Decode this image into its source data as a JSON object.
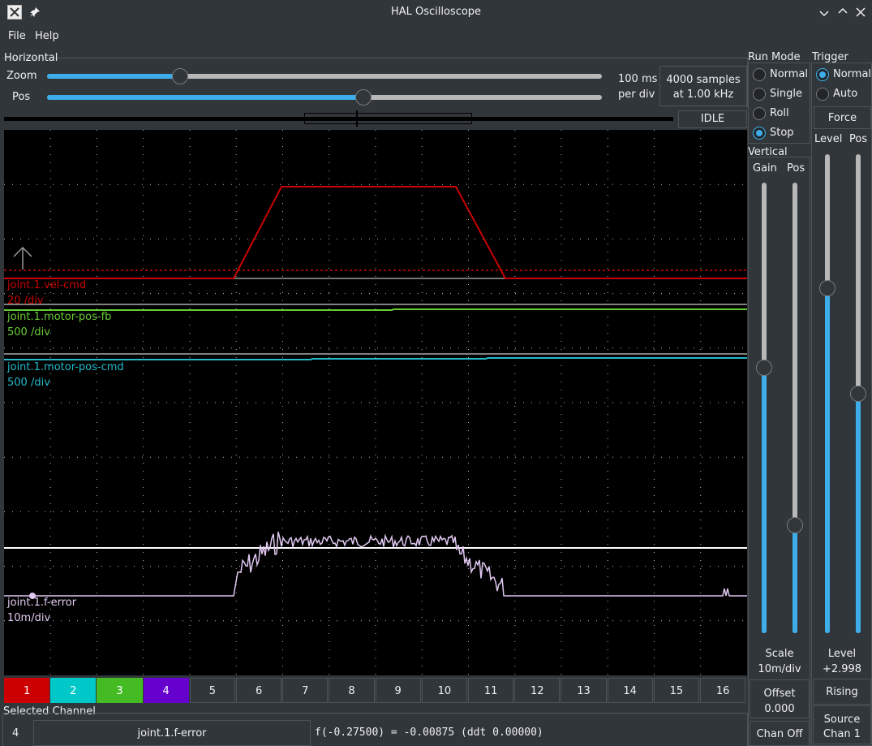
{
  "window": {
    "title": "HAL Oscilloscope",
    "icons": [
      "app-icon",
      "pin-icon",
      "minimize-icon",
      "maximize-icon",
      "close-icon"
    ]
  },
  "menu": {
    "file": "File",
    "help": "Help"
  },
  "horizontal": {
    "title": "Horizontal",
    "zoom_label": "Zoom",
    "pos_label": "Pos",
    "zoom_value": 0.24,
    "pos_value": 0.57,
    "per_div_line1": "100 ms",
    "per_div_line2": "per div",
    "samples_line1": "4000 samples",
    "samples_line2": "at 1.00 kHz",
    "status": "IDLE"
  },
  "run_mode": {
    "title": "Run Mode",
    "options": [
      "Normal",
      "Single",
      "Roll",
      "Stop"
    ],
    "selected": "Stop"
  },
  "trigger": {
    "title": "Trigger",
    "options": [
      "Normal",
      "Auto"
    ],
    "selected": "Normal",
    "force": "Force",
    "level_label": "Level",
    "pos_label": "Pos",
    "level_value": 0.72,
    "pos_value": 0.5,
    "level_title": "Level",
    "level_reading": "+2.998",
    "edge": "Rising",
    "source_line1": "Source",
    "source_line2": "Chan  1"
  },
  "vertical": {
    "title": "Vertical",
    "gain_label": "Gain",
    "pos_label": "Pos",
    "gain_value": 0.59,
    "pos_value": 0.24,
    "scale_title": "Scale",
    "scale_value": "10m/div",
    "offset_title": "Offset",
    "offset_value": "0.000",
    "chan_off": "Chan Off"
  },
  "traces": [
    {
      "name": "joint.1.vel-cmd",
      "scale": "20 /div",
      "color": "#cc0000"
    },
    {
      "name": "joint.1.motor-pos-fb",
      "scale": "500 /div",
      "color": "#66cc33"
    },
    {
      "name": "joint.1.motor-pos-cmd",
      "scale": "500 /div",
      "color": "#22bbcc"
    },
    {
      "name": "joint.1.f-error",
      "scale": "10m/div",
      "color": "#e0c8f0"
    }
  ],
  "channels": [
    {
      "label": "1",
      "color": "#cc0000"
    },
    {
      "label": "2",
      "color": "#00c8c8"
    },
    {
      "label": "3",
      "color": "#44bb22"
    },
    {
      "label": "4",
      "color": "#6600cc"
    },
    {
      "label": "5",
      "color": ""
    },
    {
      "label": "6",
      "color": ""
    },
    {
      "label": "7",
      "color": ""
    },
    {
      "label": "8",
      "color": ""
    },
    {
      "label": "9",
      "color": ""
    },
    {
      "label": "10",
      "color": ""
    },
    {
      "label": "11",
      "color": ""
    },
    {
      "label": "12",
      "color": ""
    },
    {
      "label": "13",
      "color": ""
    },
    {
      "label": "14",
      "color": ""
    },
    {
      "label": "15",
      "color": ""
    },
    {
      "label": "16",
      "color": ""
    }
  ],
  "selected_channel": {
    "title": "Selected Channel",
    "number": "4",
    "name": "joint.1.f-error",
    "readout": "f(-0.27500) = -0.00875 (ddt  0.00000)"
  }
}
